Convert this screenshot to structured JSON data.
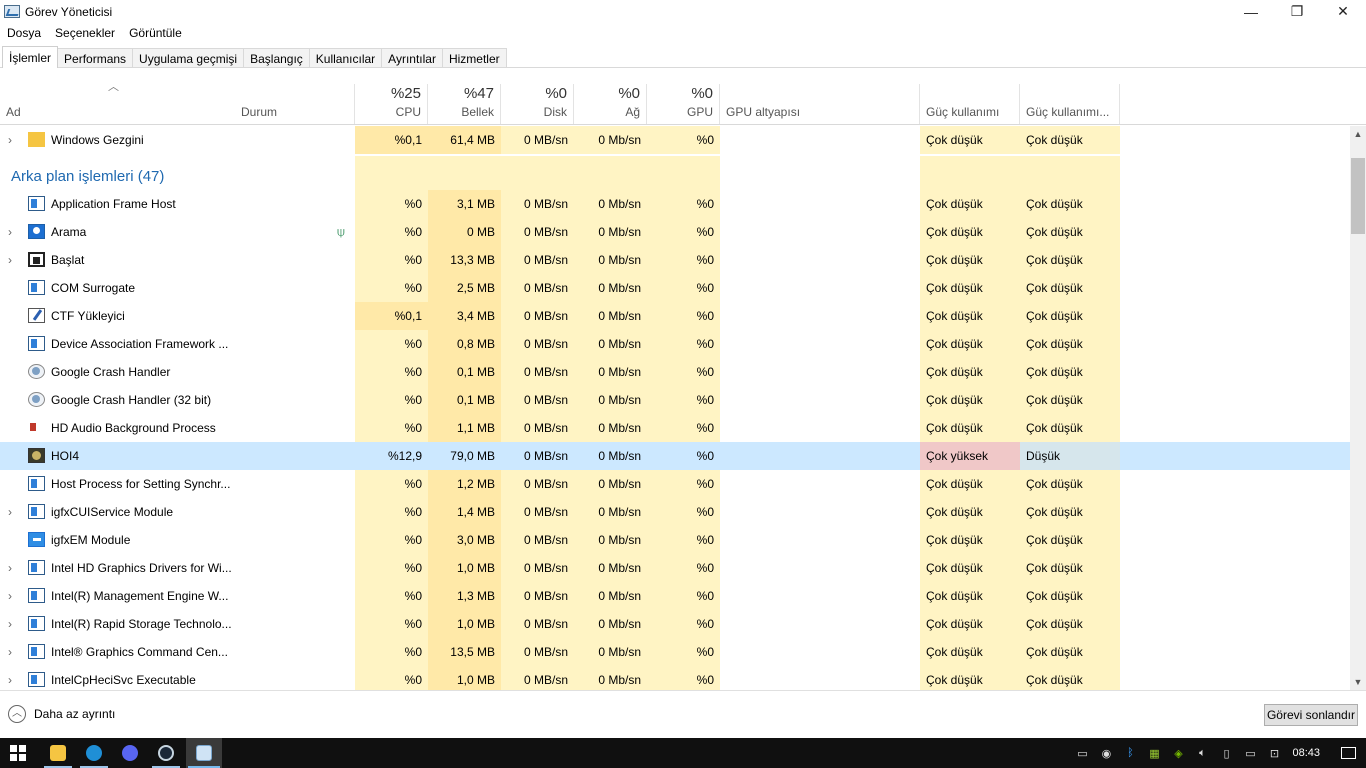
{
  "window": {
    "title": "Görev Yöneticisi",
    "controls": {
      "minimize": "—",
      "maximize": "❐",
      "close": "✕"
    }
  },
  "menu": [
    "Dosya",
    "Seçenekler",
    "Görüntüle"
  ],
  "tabs": [
    {
      "label": "İşlemler",
      "active": true
    },
    {
      "label": "Performans"
    },
    {
      "label": "Uygulama geçmişi"
    },
    {
      "label": "Başlangıç"
    },
    {
      "label": "Kullanıcılar"
    },
    {
      "label": "Ayrıntılar"
    },
    {
      "label": "Hizmetler"
    }
  ],
  "header": {
    "name": "Ad",
    "status": "Durum",
    "cpu": {
      "pct": "%25",
      "label": "CPU"
    },
    "memory": {
      "pct": "%47",
      "label": "Bellek"
    },
    "disk": {
      "pct": "%0",
      "label": "Disk"
    },
    "network": {
      "pct": "%0",
      "label": "Ağ"
    },
    "gpu": {
      "pct": "%0",
      "label": "GPU"
    },
    "gpu_engine": "GPU altyapısı",
    "power": "Güç kullanımı",
    "power_trend": "Güç kullanımı..."
  },
  "apps_rows": [
    {
      "name": "Windows Gezgini",
      "icon": "folder-icon",
      "expandable": true,
      "cpu": "%0,1",
      "mem": "61,4 MB",
      "disk": "0 MB/sn",
      "net": "0 Mb/sn",
      "gpu": "%0",
      "power": "Çok düşük",
      "trend": "Çok düşük"
    }
  ],
  "section": {
    "title": "Arka plan işlemleri (47)"
  },
  "bg_rows": [
    {
      "name": "Application Frame Host",
      "icon": "app-icon",
      "expandable": false,
      "cpu": "%0",
      "mem": "3,1 MB",
      "disk": "0 MB/sn",
      "net": "0 Mb/sn",
      "gpu": "%0",
      "power": "Çok düşük",
      "trend": "Çok düşük"
    },
    {
      "name": "Arama",
      "icon": "search-icon",
      "expandable": true,
      "leaf": true,
      "cpu": "%0",
      "mem": "0 MB",
      "disk": "0 MB/sn",
      "net": "0 Mb/sn",
      "gpu": "%0",
      "power": "Çok düşük",
      "trend": "Çok düşük"
    },
    {
      "name": "Başlat",
      "icon": "start-icon",
      "expandable": true,
      "cpu": "%0",
      "mem": "13,3 MB",
      "disk": "0 MB/sn",
      "net": "0 Mb/sn",
      "gpu": "%0",
      "power": "Çok düşük",
      "trend": "Çok düşük"
    },
    {
      "name": "COM Surrogate",
      "icon": "app-icon",
      "expandable": false,
      "cpu": "%0",
      "mem": "2,5 MB",
      "disk": "0 MB/sn",
      "net": "0 Mb/sn",
      "gpu": "%0",
      "power": "Çok düşük",
      "trend": "Çok düşük"
    },
    {
      "name": "CTF Yükleyici",
      "icon": "ctf-icon",
      "expandable": false,
      "cpu": "%0,1",
      "mem": "3,4 MB",
      "disk": "0 MB/sn",
      "net": "0 Mb/sn",
      "gpu": "%0",
      "power": "Çok düşük",
      "trend": "Çok düşük"
    },
    {
      "name": "Device Association Framework ...",
      "icon": "app-icon",
      "expandable": false,
      "cpu": "%0",
      "mem": "0,8 MB",
      "disk": "0 MB/sn",
      "net": "0 Mb/sn",
      "gpu": "%0",
      "power": "Çok düşük",
      "trend": "Çok düşük"
    },
    {
      "name": "Google Crash Handler",
      "icon": "google-icon",
      "expandable": false,
      "cpu": "%0",
      "mem": "0,1 MB",
      "disk": "0 MB/sn",
      "net": "0 Mb/sn",
      "gpu": "%0",
      "power": "Çok düşük",
      "trend": "Çok düşük"
    },
    {
      "name": "Google Crash Handler (32 bit)",
      "icon": "google-icon",
      "expandable": false,
      "cpu": "%0",
      "mem": "0,1 MB",
      "disk": "0 MB/sn",
      "net": "0 Mb/sn",
      "gpu": "%0",
      "power": "Çok düşük",
      "trend": "Çok düşük"
    },
    {
      "name": "HD Audio Background Process",
      "icon": "speaker-icon",
      "expandable": false,
      "cpu": "%0",
      "mem": "1,1 MB",
      "disk": "0 MB/sn",
      "net": "0 Mb/sn",
      "gpu": "%0",
      "power": "Çok düşük",
      "trend": "Çok düşük"
    },
    {
      "name": "HOI4",
      "icon": "game-icon",
      "expandable": false,
      "selected": true,
      "cpu": "%12,9",
      "mem": "79,0 MB",
      "disk": "0 MB/sn",
      "net": "0 Mb/sn",
      "gpu": "%0",
      "power": "Çok yüksek",
      "trend": "Düşük"
    },
    {
      "name": "Host Process for Setting Synchr...",
      "icon": "app-icon",
      "expandable": false,
      "cpu": "%0",
      "mem": "1,2 MB",
      "disk": "0 MB/sn",
      "net": "0 Mb/sn",
      "gpu": "%0",
      "power": "Çok düşük",
      "trend": "Çok düşük"
    },
    {
      "name": "igfxCUIService Module",
      "icon": "app-icon",
      "expandable": true,
      "cpu": "%0",
      "mem": "1,4 MB",
      "disk": "0 MB/sn",
      "net": "0 Mb/sn",
      "gpu": "%0",
      "power": "Çok düşük",
      "trend": "Çok düşük"
    },
    {
      "name": "igfxEM Module",
      "icon": "igfx-icon",
      "expandable": false,
      "cpu": "%0",
      "mem": "3,0 MB",
      "disk": "0 MB/sn",
      "net": "0 Mb/sn",
      "gpu": "%0",
      "power": "Çok düşük",
      "trend": "Çok düşük"
    },
    {
      "name": "Intel HD Graphics Drivers for Wi...",
      "icon": "app-icon",
      "expandable": true,
      "cpu": "%0",
      "mem": "1,0 MB",
      "disk": "0 MB/sn",
      "net": "0 Mb/sn",
      "gpu": "%0",
      "power": "Çok düşük",
      "trend": "Çok düşük"
    },
    {
      "name": "Intel(R) Management Engine W...",
      "icon": "app-icon",
      "expandable": true,
      "cpu": "%0",
      "mem": "1,3 MB",
      "disk": "0 MB/sn",
      "net": "0 Mb/sn",
      "gpu": "%0",
      "power": "Çok düşük",
      "trend": "Çok düşük"
    },
    {
      "name": "Intel(R) Rapid Storage Technolo...",
      "icon": "app-icon",
      "expandable": true,
      "cpu": "%0",
      "mem": "1,0 MB",
      "disk": "0 MB/sn",
      "net": "0 Mb/sn",
      "gpu": "%0",
      "power": "Çok düşük",
      "trend": "Çok düşük"
    },
    {
      "name": "Intel® Graphics Command Cen...",
      "icon": "app-icon",
      "expandable": true,
      "cpu": "%0",
      "mem": "13,5 MB",
      "disk": "0 MB/sn",
      "net": "0 Mb/sn",
      "gpu": "%0",
      "power": "Çok düşük",
      "trend": "Çok düşük"
    },
    {
      "name": "IntelCpHeciSvc Executable",
      "icon": "app-icon",
      "expandable": true,
      "cpu": "%0",
      "mem": "1,0 MB",
      "disk": "0 MB/sn",
      "net": "0 Mb/sn",
      "gpu": "%0",
      "power": "Çok düşük",
      "trend": "Çok düşük"
    }
  ],
  "footer": {
    "fewer_details": "Daha az ayrıntı",
    "end_task": "Görevi sonlandır"
  },
  "taskbar": {
    "apps": [
      "file-explorer-icon",
      "edge-icon",
      "discord-icon",
      "steam-icon",
      "task-manager-icon"
    ],
    "tray_icons": [
      "monitor-icon",
      "steam-tray-icon",
      "bluetooth-icon",
      "gpu-tray-icon",
      "nvidia-icon",
      "volume-icon",
      "usb-icon",
      "power-icon",
      "network-icon"
    ],
    "time": "08:43"
  },
  "colors": {
    "heat_light": "#fff4c4",
    "heat_mid": "#ffe9a8",
    "selected_row": "#cce8ff",
    "high_power": "#f0c8c8",
    "section_title": "#1f69b0"
  }
}
